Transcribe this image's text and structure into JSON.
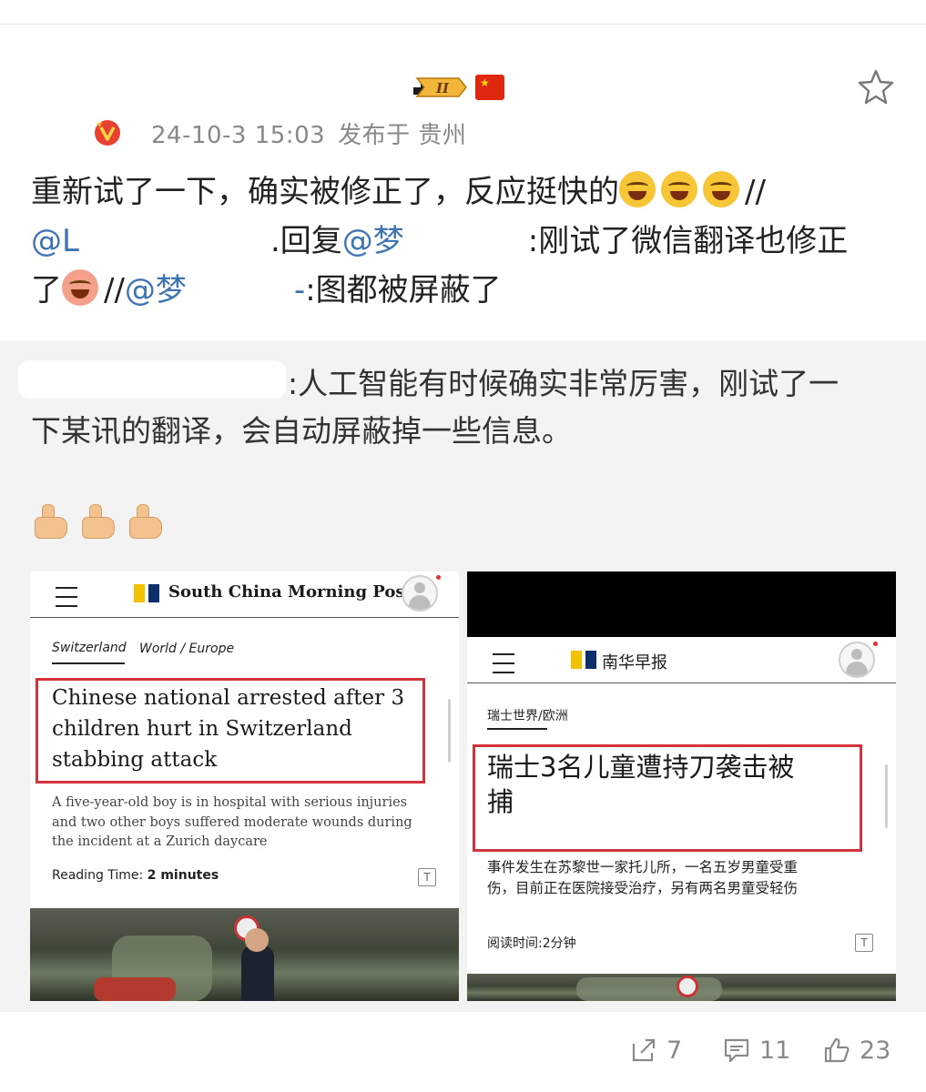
{
  "post": {
    "timestamp": "24-10-3 15:03",
    "location": "发布于 贵州",
    "text": {
      "line1": "重新试了一下，确实被修正了，反应挺快的",
      "line1_tail": "//",
      "mention1": "@L",
      "reply_text": ".回复",
      "mention2": "@梦",
      "line2_tail": ":刚试了微信翻译也修正",
      "line3_head": "了",
      "line3_sep": "//",
      "mention3": "@梦",
      "line3_dash": "-",
      "line3_tail": ":图都被屏蔽了"
    }
  },
  "badges": {
    "rank": "II"
  },
  "quote": {
    "line1": ":人工智能有时候确实非常厉害，刚试了一",
    "line2": "下某讯的翻译，会自动屏蔽掉一些信息。"
  },
  "left_screenshot": {
    "logo": "South China Morning Post",
    "section1": "Switzerland",
    "section2": "World / Europe",
    "headline": [
      "Chinese national arrested after 3",
      "children hurt in Switzerland",
      "stabbing attack"
    ],
    "summary": [
      "A five-year-old boy is in hospital with serious injuries",
      "and two other boys suffered moderate wounds during",
      "the incident at a Zurich daycare"
    ],
    "reading_label": "Reading Time: ",
    "reading_value": "2 minutes",
    "font_icon": "T"
  },
  "right_screenshot": {
    "logo": "南华早报",
    "section": "瑞士世界/欧洲",
    "headline": [
      "瑞士3名儿童遭持刀袭击被",
      "捕"
    ],
    "summary": [
      "事件发生在苏黎世一家托儿所，一名五岁男童受重",
      "伤，目前正在医院接受治疗，另有两名男童受轻伤"
    ],
    "reading": "阅读时间:2分钟",
    "font_icon": "T"
  },
  "actions": {
    "shares": "7",
    "comments": "11",
    "likes": "23"
  },
  "colors": {
    "link": "#3f74b2",
    "quote_bg": "#f3f3f3",
    "highlight_box": "#d2323a"
  }
}
